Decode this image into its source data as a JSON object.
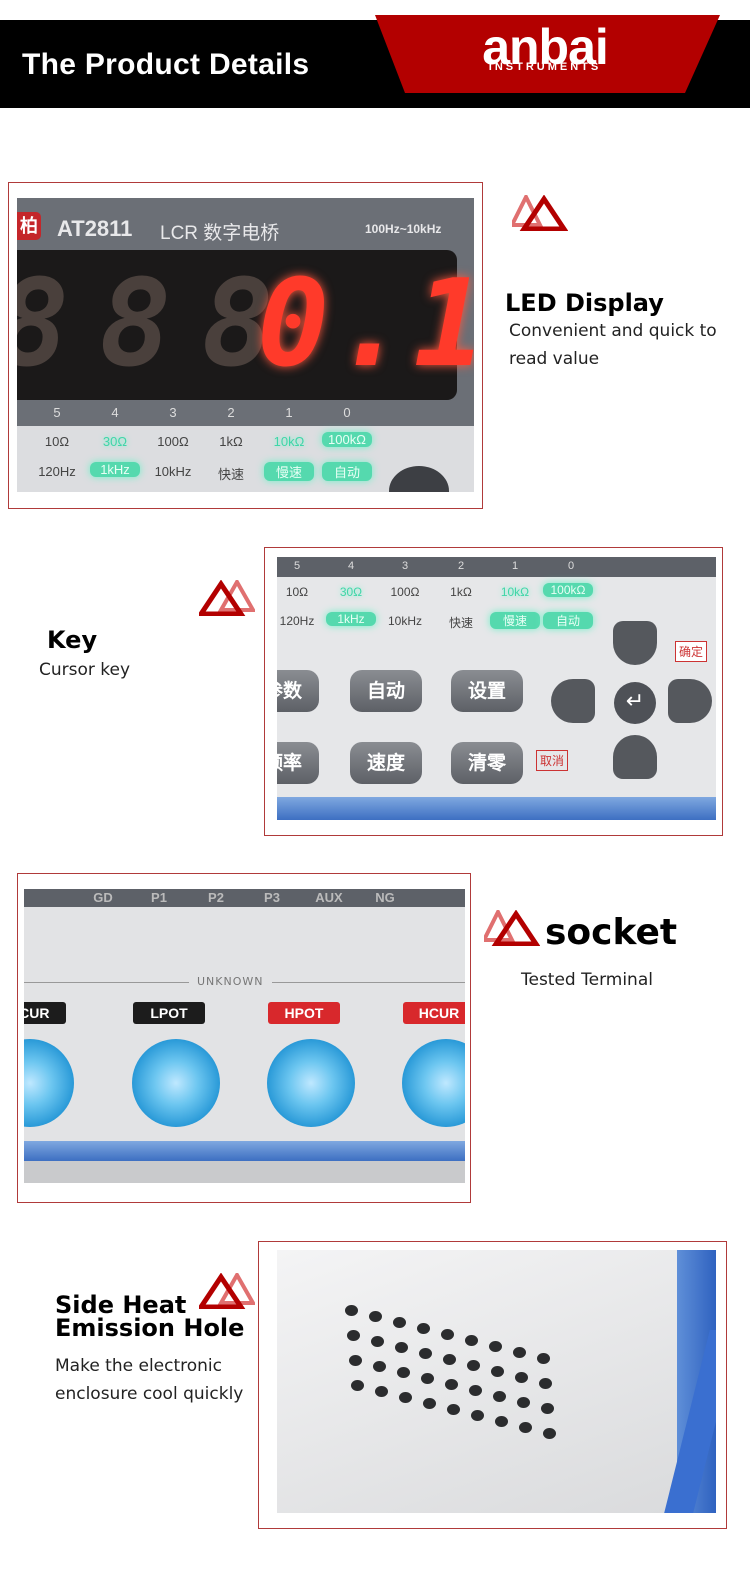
{
  "header": {
    "title": "The Product Details",
    "logo_main": "anbai",
    "logo_sub": "INSTRUMENTS",
    "brand_color": "#b30000"
  },
  "sections": [
    {
      "heading": "LED  Display",
      "description": "Convenient and quick to read value",
      "photo": {
        "brand_mark": "柏",
        "model": "AT2811",
        "subtitle": "LCR 数字电桥",
        "range": "100Hz~10kHz",
        "reading": "0.1",
        "indices": [
          "5",
          "4",
          "3",
          "2",
          "1",
          "0"
        ],
        "row1": [
          "10Ω",
          "30Ω",
          "100Ω",
          "1kΩ",
          "10kΩ",
          "100kΩ"
        ],
        "row2": [
          "120Hz",
          "1kHz",
          "10kHz",
          "快速",
          "慢速",
          "自动"
        ]
      }
    },
    {
      "heading": "Key",
      "description": "Cursor key",
      "photo": {
        "indices": [
          "5",
          "4",
          "3",
          "2",
          "1",
          "0"
        ],
        "row1": [
          "10Ω",
          "30Ω",
          "100Ω",
          "1kΩ",
          "10kΩ",
          "100kΩ"
        ],
        "row2": [
          "120Hz",
          "1kHz",
          "10kHz",
          "快速",
          "慢速",
          "自动"
        ],
        "keys": [
          "参数",
          "自动",
          "设置",
          "频率",
          "速度",
          "清零"
        ],
        "confirm_label": "确定",
        "cancel_label": "取消"
      }
    },
    {
      "heading": "socket",
      "description": "Tested Terminal",
      "photo": {
        "top_labels": [
          "GD",
          "P1",
          "P2",
          "P3",
          "AUX",
          "NG"
        ],
        "group_label": "UNKNOWN",
        "terminals": [
          "LCUR",
          "LPOT",
          "HPOT",
          "HCUR"
        ]
      }
    },
    {
      "heading": "Side Heat Emission Hole",
      "description": "Make the electronic enclosure cool quickly"
    }
  ]
}
